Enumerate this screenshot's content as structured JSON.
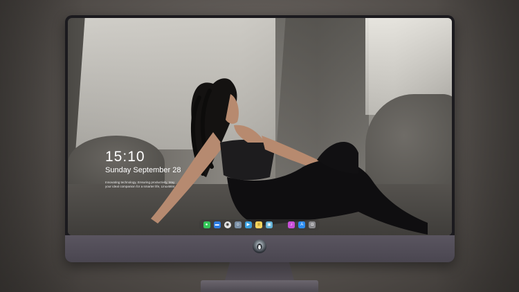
{
  "lock_screen": {
    "time": "15:10",
    "date": "Sunday September 28",
    "tagline": "Innovating technology, Ensuring productivity, May your ideal companion for a smarter life, LinuxMint"
  },
  "dock": {
    "items": [
      {
        "name": "messages-icon",
        "color": "#34c759",
        "glyph": "●"
      },
      {
        "name": "files-icon",
        "color": "#2f7de1",
        "glyph": "▬"
      },
      {
        "name": "browser-icon",
        "color": "#e6e6e6",
        "glyph": "◉"
      },
      {
        "name": "finder-icon",
        "color": "#7a8fa6",
        "glyph": "☺"
      },
      {
        "name": "video-icon",
        "color": "#3aa0e0",
        "glyph": "▶"
      },
      {
        "name": "notes-icon",
        "color": "#f4d35e",
        "glyph": "≡"
      },
      {
        "name": "photos-icon",
        "color": "#5fb0d6",
        "glyph": "▣"
      },
      {
        "name": "music-icon",
        "color": "#c94fd8",
        "glyph": "♪"
      },
      {
        "name": "app-store-icon",
        "color": "#2c8cf0",
        "glyph": "A"
      },
      {
        "name": "camera-icon",
        "color": "#8a8a8e",
        "glyph": "◘"
      }
    ]
  },
  "colors": {
    "monitor_bezel": "#1b1a1e",
    "monitor_chin": "#5a5560",
    "dock_background": "#3c3a38"
  }
}
